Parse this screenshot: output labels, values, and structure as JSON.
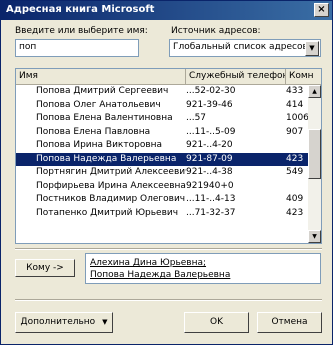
{
  "window": {
    "title": "Адресная книга Microsoft",
    "close_glyph": "×"
  },
  "search": {
    "label": "Введите или выберите имя:",
    "value": "поп"
  },
  "source": {
    "label": "Источник адресов:",
    "value": "Глобальный список адресов"
  },
  "list": {
    "columns": [
      "Имя",
      "Служебный телефон",
      "Комн"
    ],
    "rows": [
      {
        "name": "Попова Дмитрий Сергеевич",
        "phone": "...52-02-30",
        "room": "433",
        "selected": false
      },
      {
        "name": "Попова Олег Анатольевич",
        "phone": "921-39-46",
        "room": "414",
        "selected": false
      },
      {
        "name": "Попова Елена Валентиновна",
        "phone": "...57",
        "room": "1006",
        "selected": false
      },
      {
        "name": "Попова Елена Павловна",
        "phone": "...11-..5-09",
        "room": "907",
        "selected": false
      },
      {
        "name": "Попова Ирина Викторовна",
        "phone": "921-..4-20",
        "room": "",
        "selected": false
      },
      {
        "name": "Попова Надежда Валерьевна",
        "phone": "921-87-09",
        "room": "423",
        "selected": true
      },
      {
        "name": "Портнягин Дмитрий Алексеевич",
        "phone": "921-..4-38",
        "room": "549",
        "selected": false
      },
      {
        "name": "Порфирьева Ирина Алексеевна",
        "phone": "921940+0",
        "room": "",
        "selected": false
      },
      {
        "name": "Постников Владимир Олегович",
        "phone": "...11-..4-13",
        "room": "409",
        "selected": false
      },
      {
        "name": "Потапенко Дмитрий Юрьевич",
        "phone": "...71-32-37",
        "room": "423",
        "selected": false
      }
    ]
  },
  "recipients": {
    "button_label": "Кому ->",
    "entries": [
      "Алехина Дина Юрьевна;",
      "Попова Надежда Валерьевна"
    ]
  },
  "footer": {
    "advanced_label": "Дополнительно",
    "advanced_arrow": "▼",
    "ok_label": "OK",
    "cancel_label": "Отмена"
  },
  "icons": {
    "close": "close-icon",
    "dropdown": "chevron-down-icon",
    "scroll_up": "scroll-up-icon",
    "scroll_down": "scroll-down-icon"
  },
  "colors": {
    "title_bar": "#0a246a",
    "selection": "#0a246a",
    "dialog_bg": "#ece9d8"
  }
}
